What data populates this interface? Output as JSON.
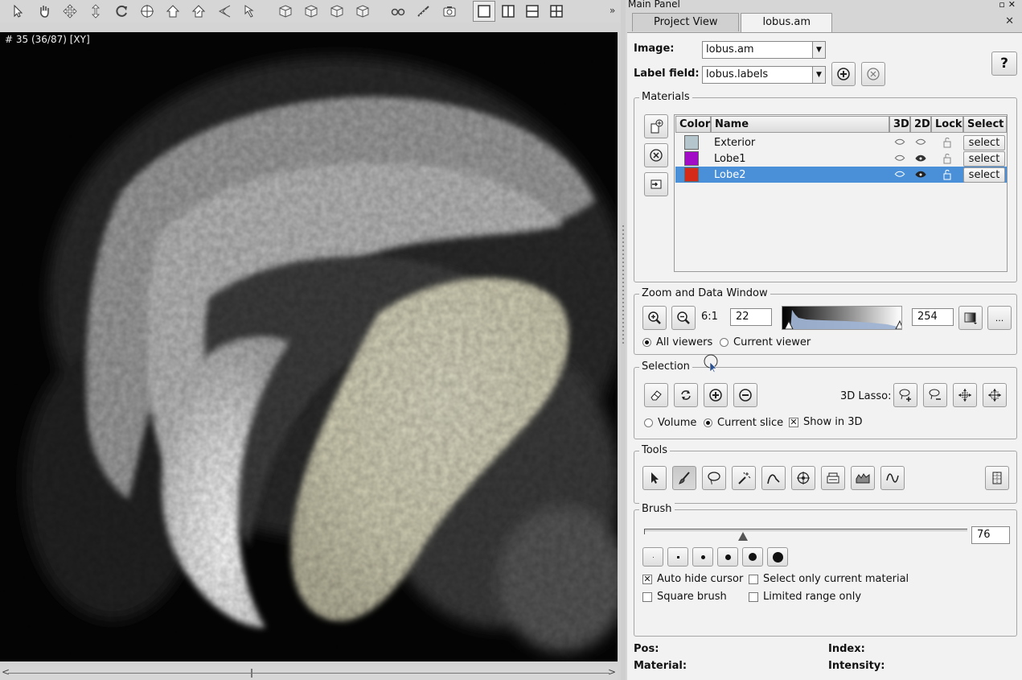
{
  "viewer": {
    "slice_label": "# 35 (36/87) [XY]",
    "toolbar_icons": [
      "pointer-icon",
      "hand-icon",
      "move-icon",
      "vertical-move-icon",
      "rotate-icon",
      "target-icon",
      "home-icon",
      "set-home-icon",
      "perspective-icon",
      "pick-icon",
      "view-x-icon",
      "view-y-icon",
      "view-z-icon",
      "view-xyz-icon",
      "stereo-icon",
      "measure-icon",
      "snapshot-icon"
    ],
    "layouts": [
      "single-view-layout",
      "two-vertical-layout",
      "two-horizontal-layout",
      "four-view-layout"
    ]
  },
  "panel": {
    "title": "Main Panel",
    "tabs": [
      {
        "label": "Project View"
      },
      {
        "label": "lobus.am"
      }
    ],
    "image_label": "Image:",
    "image_value": "lobus.am",
    "labelfield_label": "Label field:",
    "labelfield_value": "lobus.labels",
    "help_label": "?"
  },
  "materials": {
    "title": "Materials",
    "headers": {
      "color": "Color",
      "name": "Name",
      "d3": "3D",
      "d2": "2D",
      "lock": "Lock",
      "select": "Select"
    },
    "rows": [
      {
        "name": "Exterior",
        "color": "#b4c6cc",
        "select": "select"
      },
      {
        "name": "Lobe1",
        "color": "#a20cc6",
        "select": "select"
      },
      {
        "name": "Lobe2",
        "color": "#d42a1a",
        "select": "select"
      }
    ]
  },
  "zoom": {
    "title": "Zoom and Data Window",
    "ratio": "6:1",
    "min": "22",
    "max": "254",
    "more": "...",
    "all_viewers": "All viewers",
    "current_viewer": "Current viewer"
  },
  "selection": {
    "title": "Selection",
    "lasso_label": "3D Lasso:",
    "volume": "Volume",
    "current_slice": "Current slice",
    "show_in_3d": "Show in 3D"
  },
  "tools": {
    "title": "Tools"
  },
  "brush": {
    "title": "Brush",
    "size": "76",
    "size_fraction": 0.31,
    "auto_hide": "Auto hide cursor",
    "select_only": "Select only current material",
    "square": "Square brush",
    "limited": "Limited range only"
  },
  "status": {
    "pos": "Pos:",
    "index": "Index:",
    "material": "Material:",
    "intensity": "Intensity:"
  },
  "colors": {
    "selection_blue": "#4a90d9",
    "panel_bg": "#f2f2f2"
  }
}
